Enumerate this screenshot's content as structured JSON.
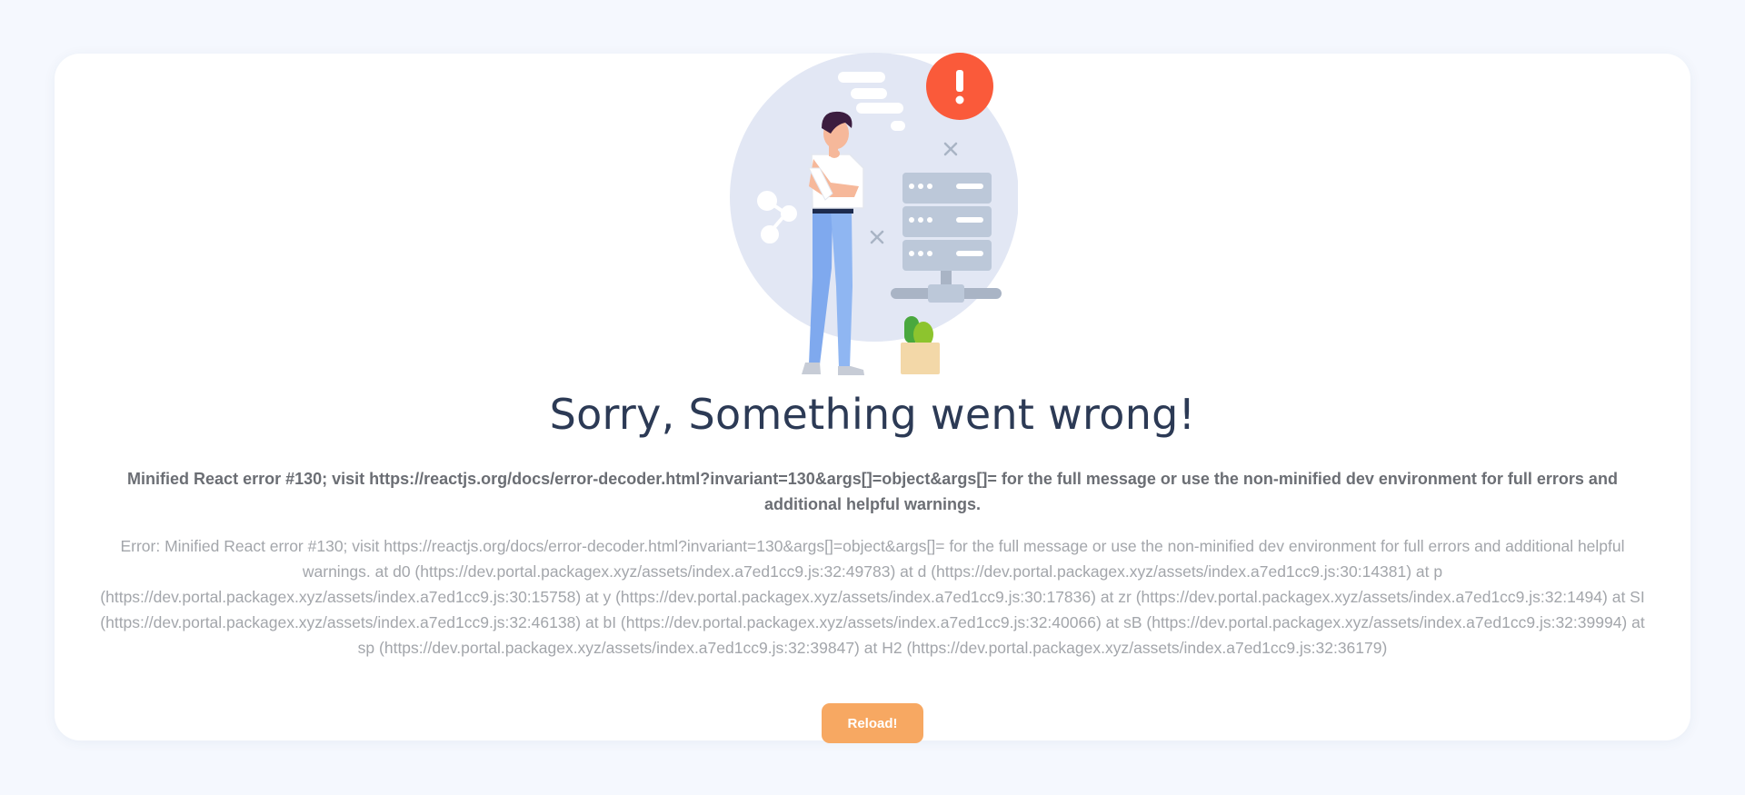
{
  "page": {
    "title": "Sorry, Something went wrong!",
    "error_message": "Minified React error #130; visit https://reactjs.org/docs/error-decoder.html?invariant=130&args[]=object&args[]= for the full message or use the non-minified dev environment for full errors and additional helpful warnings.",
    "error_stack": "Error: Minified React error #130; visit https://reactjs.org/docs/error-decoder.html?invariant=130&args[]=object&args[]= for the full message or use the non-minified dev environment for full errors and additional helpful warnings. at d0 (https://dev.portal.packagex.xyz/assets/index.a7ed1cc9.js:32:49783) at d (https://dev.portal.packagex.xyz/assets/index.a7ed1cc9.js:30:14381) at p (https://dev.portal.packagex.xyz/assets/index.a7ed1cc9.js:30:15758) at y (https://dev.portal.packagex.xyz/assets/index.a7ed1cc9.js:30:17836) at zr (https://dev.portal.packagex.xyz/assets/index.a7ed1cc9.js:32:1494) at SI (https://dev.portal.packagex.xyz/assets/index.a7ed1cc9.js:32:46138) at bI (https://dev.portal.packagex.xyz/assets/index.a7ed1cc9.js:32:40066) at sB (https://dev.portal.packagex.xyz/assets/index.a7ed1cc9.js:32:39994) at sp (https://dev.portal.packagex.xyz/assets/index.a7ed1cc9.js:32:39847) at H2 (https://dev.portal.packagex.xyz/assets/index.a7ed1cc9.js:32:36179)",
    "reload_label": "Reload!",
    "alert_symbol": "!"
  },
  "colors": {
    "background": "#f5f8fe",
    "card": "#ffffff",
    "title": "#2c3a55",
    "message": "#6b6e74",
    "stack": "#a3a6ab",
    "reload_button": "#f7a862",
    "alert_badge": "#fa5a3a",
    "server": "#bcc8d9",
    "illustration_circle": "#e2e7f4"
  },
  "icons": {
    "illustration": "person-and-server-illustration",
    "alert": "exclamation-alert-icon",
    "server": "server-rack-icon",
    "plant": "potted-plant-icon",
    "share": "share-nodes-icon"
  }
}
